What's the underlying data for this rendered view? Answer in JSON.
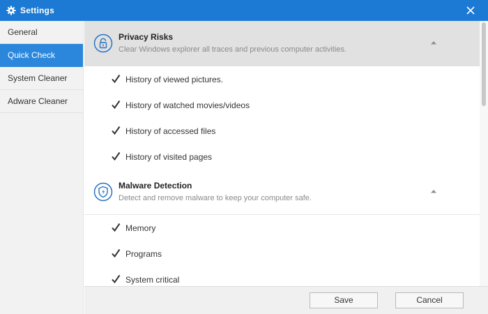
{
  "window": {
    "title": "Settings"
  },
  "sidebar": {
    "items": [
      {
        "label": "General"
      },
      {
        "label": "Quick Check"
      },
      {
        "label": "System Cleaner"
      },
      {
        "label": "Adware Cleaner"
      }
    ],
    "active_index": 1
  },
  "sections": [
    {
      "title": "Privacy Risks",
      "description": "Clear Windows explorer all traces and previous computer activities.",
      "icon": "lock-icon",
      "expanded": true,
      "items": [
        {
          "label": "History of viewed pictures.",
          "checked": true
        },
        {
          "label": "History of watched movies/videos",
          "checked": true
        },
        {
          "label": "History of accessed files",
          "checked": true
        },
        {
          "label": "History of visited pages",
          "checked": true
        }
      ]
    },
    {
      "title": "Malware Detection",
      "description": "Detect and remove malware to keep your computer safe.",
      "icon": "shield-icon",
      "expanded": true,
      "items": [
        {
          "label": "Memory",
          "checked": true
        },
        {
          "label": "Programs",
          "checked": true
        },
        {
          "label": "System critical",
          "checked": true
        }
      ]
    }
  ],
  "footer": {
    "save_label": "Save",
    "cancel_label": "Cancel"
  },
  "colors": {
    "titlebar": "#1c7ad4",
    "active_item": "#2b87dc",
    "section_header_bg": "#e1e1e1"
  }
}
